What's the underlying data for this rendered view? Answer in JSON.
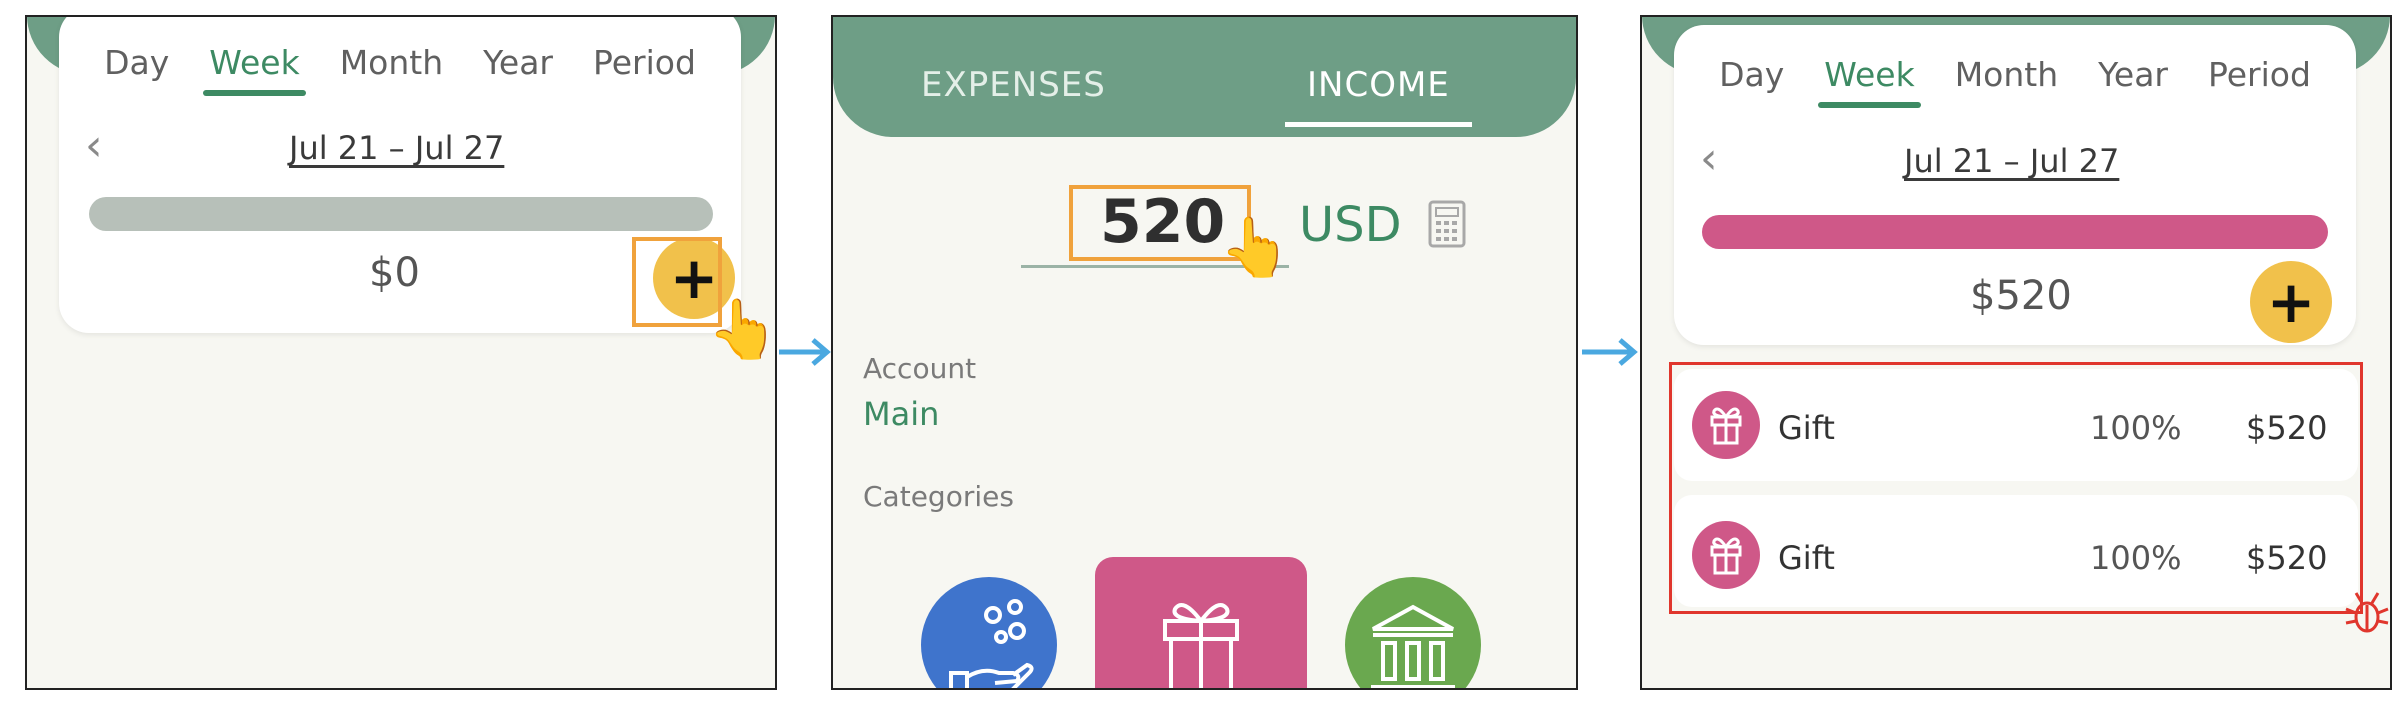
{
  "colors": {
    "brand_green": "#6e9e86",
    "accent_green": "#3d8a63",
    "fab_yellow": "#f1c14b",
    "gift_pink": "#cf5888",
    "highlight_orange": "#f0a23c",
    "highlight_red": "#e0362d",
    "arrow_blue": "#4aa8e0"
  },
  "panel1": {
    "tabs": [
      "Day",
      "Week",
      "Month",
      "Year",
      "Period"
    ],
    "active_tab": "Week",
    "date_range": "Jul 21 – Jul 27",
    "amount": "$0",
    "fab_label": "+",
    "fab_icon": "plus-icon",
    "pointer_icon": "hand-pointer-icon"
  },
  "panel2": {
    "tabs": [
      "EXPENSES",
      "INCOME"
    ],
    "active_tab": "INCOME",
    "amount_value": "520",
    "currency": "USD",
    "calculator_icon": "calculator-icon",
    "account_label": "Account",
    "account_value": "Main",
    "categories_label": "Categories",
    "categories": [
      {
        "icon": "hand-coins-icon",
        "color": "#3f74cc"
      },
      {
        "icon": "gift-icon",
        "color": "#cf5888"
      },
      {
        "icon": "bank-icon",
        "color": "#6aa84f"
      }
    ]
  },
  "panel3": {
    "tabs": [
      "Day",
      "Week",
      "Month",
      "Year",
      "Period"
    ],
    "active_tab": "Week",
    "date_range": "Jul 21 – Jul 27",
    "amount": "$520",
    "fab_label": "+",
    "rows": [
      {
        "icon": "gift-icon",
        "name": "Gift",
        "percent": "100%",
        "amount": "$520"
      },
      {
        "icon": "gift-icon",
        "name": "Gift",
        "percent": "100%",
        "amount": "$520"
      }
    ],
    "bug_icon": "bug-icon"
  }
}
